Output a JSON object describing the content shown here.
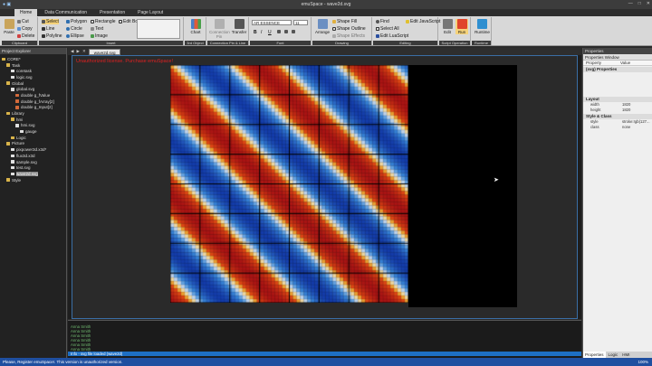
{
  "window": {
    "title": "emuSpace - wave2d.svg"
  },
  "menu_tabs": [
    "Home",
    "Data Communication",
    "Presentation",
    "Page Layout"
  ],
  "ribbon": {
    "clipboard": {
      "label": "Clipboard",
      "paste": "Paste",
      "cut": "Cut",
      "copy": "Copy",
      "delete": "Delete"
    },
    "insert": {
      "label": "Insert",
      "select": "Select",
      "line": "Line",
      "polyline": "Polyline",
      "polygon": "Polygon",
      "circle": "Circle",
      "ellipse": "Ellipse",
      "rectangle": "Rectangle",
      "text": "Text",
      "image": "Image",
      "edit_box": "Edit Box"
    },
    "chart": {
      "label": "3rd Object",
      "chart": "Chart"
    },
    "connection": {
      "label": "Connection Pin & Line",
      "pin": "Connection Pin",
      "transfer": "Transfer"
    },
    "font": {
      "label": "Font",
      "family": "AR ESSENCE",
      "size": "11",
      "bold": "B",
      "italic": "I",
      "underline": "U"
    },
    "drawing": {
      "label": "Drawing",
      "arrange": "Arrange",
      "shape_fill": "Shape Fill",
      "shape_outline": "Shape Outline",
      "shape_effects": "Shape Effects"
    },
    "editing": {
      "label": "Editing",
      "find": "Find",
      "select_all": "Select All",
      "edit_javascript": "Edit JavaScript",
      "edit_luascript": "Edit LuaScript"
    },
    "operation": {
      "label": "Script Operation",
      "edit": "Edit",
      "run": "Run"
    },
    "runtime": {
      "label": "Runtime",
      "runtime": "Runtime"
    }
  },
  "project_explorer": {
    "title": "Project Explorer",
    "items": [
      {
        "label": "CORE*",
        "level": 0,
        "color": "#d9b44a"
      },
      {
        "label": "Task",
        "level": 1,
        "color": "#d9b44a"
      },
      {
        "label": "coretask",
        "level": 2,
        "color": "#e0e0e0"
      },
      {
        "label": "logic.svg",
        "level": 2,
        "color": "#e0e0e0"
      },
      {
        "label": "Global",
        "level": 1,
        "color": "#d9b44a"
      },
      {
        "label": "global.svg",
        "level": 2,
        "color": "#e0e0e0"
      },
      {
        "label": "double g_fValue",
        "level": 3,
        "color": "#d46a3a"
      },
      {
        "label": "double g_fArray[2]",
        "level": 3,
        "color": "#d46a3a"
      },
      {
        "label": "double g_Input[2]",
        "level": 3,
        "color": "#d46a3a"
      },
      {
        "label": "Library",
        "level": 1,
        "color": "#d9b44a"
      },
      {
        "label": "hmi",
        "level": 2,
        "color": "#d9b44a"
      },
      {
        "label": "hmi.svg",
        "level": 3,
        "color": "#e0e0e0"
      },
      {
        "label": "gauge",
        "level": 4,
        "color": "#e0e0e0"
      },
      {
        "label": "Logic",
        "level": 2,
        "color": "#d9b44a"
      },
      {
        "label": "Picture",
        "level": 1,
        "color": "#d9b44a"
      },
      {
        "label": "pixpower3d.x3d*",
        "level": 2,
        "color": "#e0e0e0"
      },
      {
        "label": "flux3d.x3d",
        "level": 2,
        "color": "#e0e0e0"
      },
      {
        "label": "sample.svg",
        "level": 2,
        "color": "#e0e0e0"
      },
      {
        "label": "test.svg",
        "level": 2,
        "color": "#e0e0e0"
      },
      {
        "label": "wave2d.svg",
        "level": 2,
        "color": "#e0e0e0",
        "selected": true
      },
      {
        "label": "Style",
        "level": 1,
        "color": "#d9b44a"
      }
    ]
  },
  "document": {
    "tab": "wave2d.svg",
    "watermark": "Unauthorized license. Purchase emuSpace!"
  },
  "wave": {
    "rows": 66,
    "cols": 66,
    "grid": 8,
    "period": 30
  },
  "colors": {
    "accent": "#1e6fc4",
    "status_bar": "#1f4fa0",
    "watermark": "#e02020"
  },
  "properties": {
    "title": "Properties",
    "window": "Properties Window",
    "col_property": "Property",
    "col_value": "Value",
    "svg_section": "(svg) Properties",
    "layout_section": "Layout",
    "width_label": "width",
    "width_value": "1820",
    "height_label": "height",
    "height_value": "1820",
    "style_section": "Style & Class",
    "style_label": "style",
    "style_value": "stroke:rgb(127...",
    "class_label": "class",
    "class_value": "none",
    "tabs": [
      "Properties",
      "Logic",
      "HMI"
    ]
  },
  "output": {
    "lines": [
      "Anna Smith",
      "Anna Smith",
      "Anna Smith",
      "Anna Smith",
      "Anna Smith",
      "Anna Smith"
    ],
    "highlight": "Info - svg file loaded (wave2d)"
  },
  "status": {
    "text": "Please, Register emuSpace!. This version is unauthorized version.",
    "zoom": "100%"
  }
}
